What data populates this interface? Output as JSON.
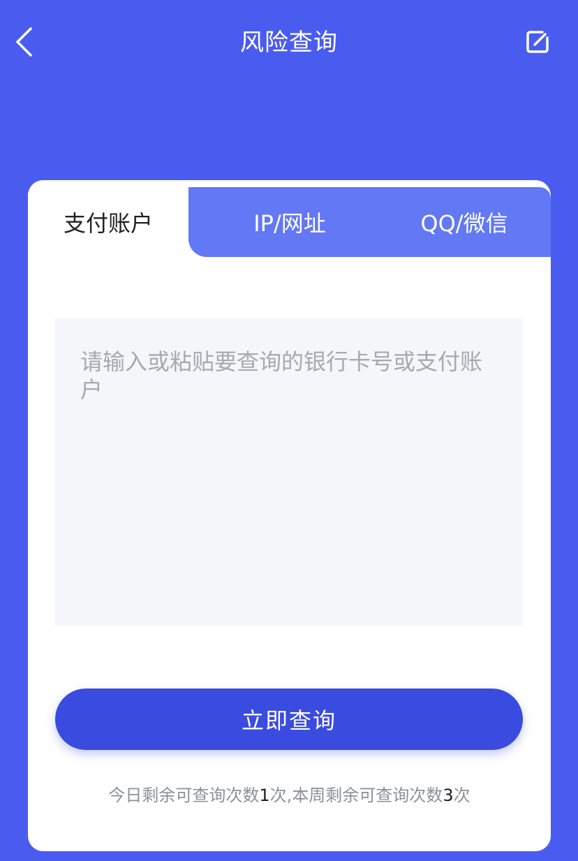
{
  "header": {
    "title": "风险查询",
    "back_icon": "chevron-left-icon",
    "edit_icon": "edit-icon"
  },
  "tabs": [
    {
      "label": "支付账户",
      "active": true
    },
    {
      "label": "IP/网址",
      "active": false
    },
    {
      "label": "QQ/微信",
      "active": false
    }
  ],
  "query": {
    "placeholder": "请输入或粘贴要查询的银行卡号或支付账户",
    "value": ""
  },
  "submit": {
    "label": "立即查询"
  },
  "quota": {
    "daily_prefix": "今日剩余可查询次数",
    "daily_count": "1",
    "daily_suffix": "次,",
    "weekly_prefix": "本周剩余可查询次数",
    "weekly_count": "3",
    "weekly_suffix": "次"
  },
  "colors": {
    "background": "#4a5cf0",
    "tab_strip": "#6278f4",
    "button": "#3a4be0",
    "input_bg": "#f5f6fa"
  }
}
